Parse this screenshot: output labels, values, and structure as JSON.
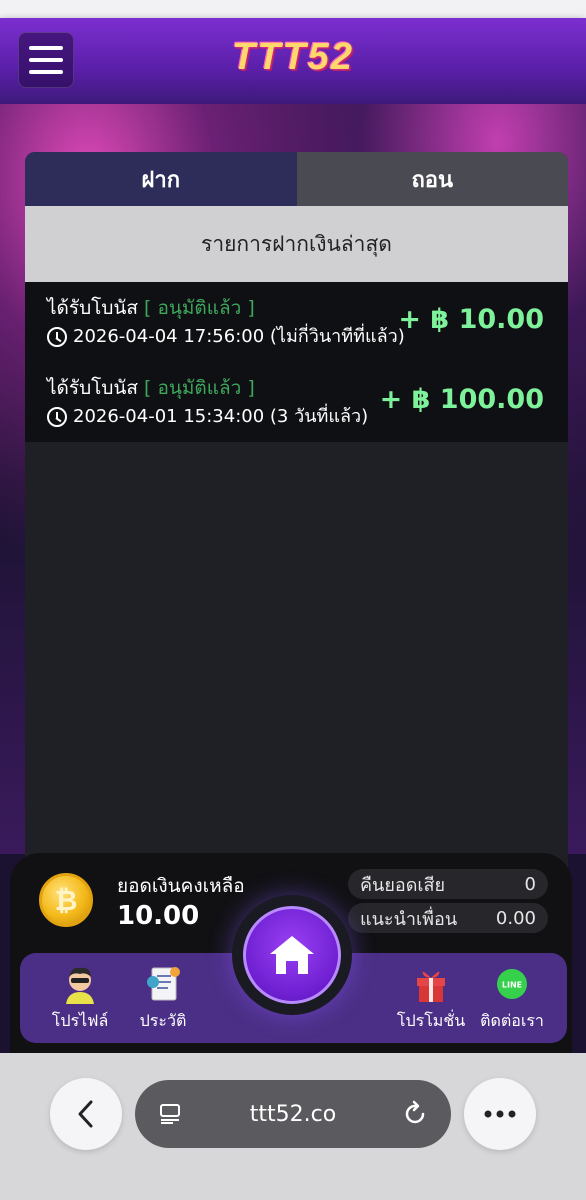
{
  "header": {
    "logo_text": "TTT52"
  },
  "tabs": [
    {
      "label": "ฝาก",
      "active": true
    },
    {
      "label": "ถอน",
      "active": false
    }
  ],
  "list_title": "รายการฝากเงินล่าสุด",
  "transactions": [
    {
      "title": "ได้รับโบนัส",
      "status": "[ อนุมัติแล้ว ]",
      "datetime": "2026-04-04 17:56:00 (ไม่กี่วินาทีที่แล้ว)",
      "amount": "+ ฿ 10.00"
    },
    {
      "title": "ได้รับโบนัส",
      "status": "[ อนุมัติแล้ว ]",
      "datetime": "2026-04-01 15:34:00 (3 วันที่แล้ว)",
      "amount": "+ ฿ 100.00"
    }
  ],
  "wallet": {
    "balance_label": "ยอดเงินคงเหลือ",
    "balance_value": "10.00",
    "cashback_label": "คืนยอดเสีย",
    "cashback_value": "0",
    "referral_label": "แนะนำเพื่อน",
    "referral_value": "0.00"
  },
  "nav": {
    "profile": "โปรไฟล์",
    "history": "ประวัติ",
    "promotion": "โปรโมชั่น",
    "contact": "ติดต่อเรา"
  },
  "browser": {
    "url": "ttt52.co"
  },
  "colors": {
    "accent_green": "#7ef29a",
    "status_green": "#3ea75c",
    "tab_active": "#2e2d59",
    "nav_purple": "#4b2f86"
  }
}
